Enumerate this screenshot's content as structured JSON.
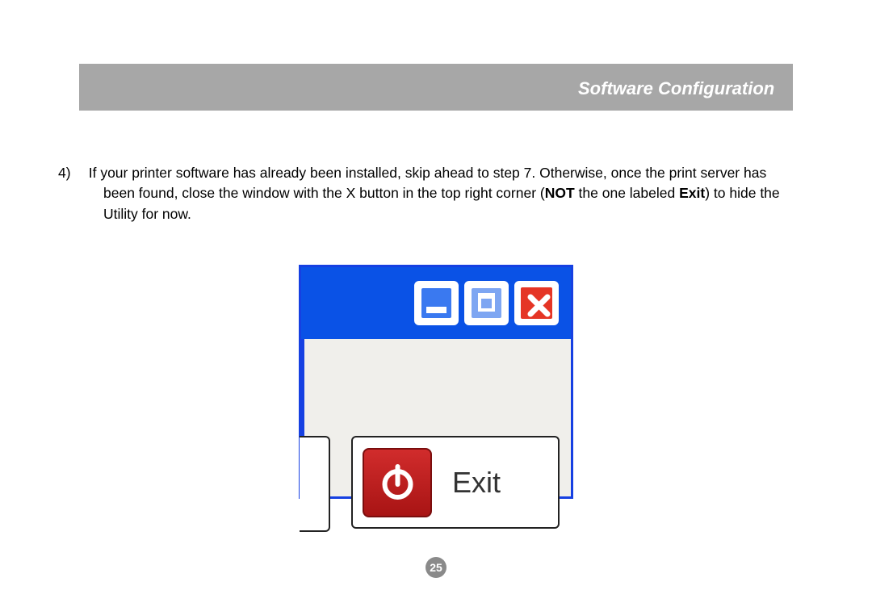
{
  "header": {
    "title": "Software Configuration"
  },
  "step": {
    "number": "4)",
    "text_before_not": "If your printer software has already been installed, skip ahead to step 7.  Otherwise, once the print server has been found, close the window with the X button in the top right corner (",
    "not_word": "NOT",
    "text_mid": " the one labeled ",
    "exit_word": "Exit",
    "text_after": ") to hide the Utility for now."
  },
  "figure": {
    "exit_button_label": "Exit"
  },
  "page_number": "25"
}
